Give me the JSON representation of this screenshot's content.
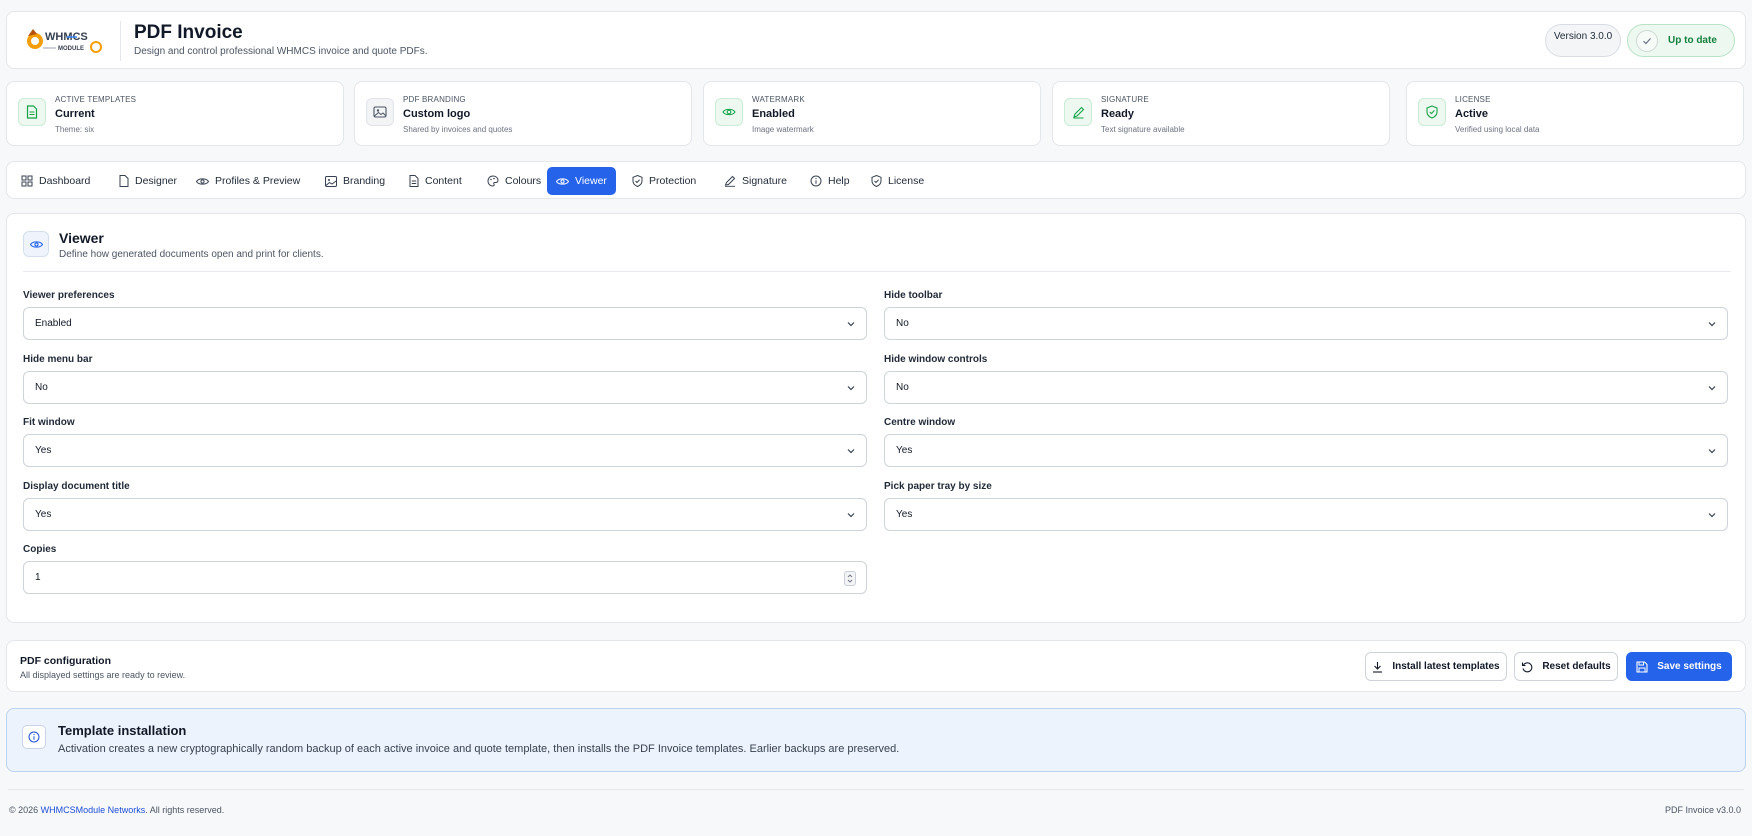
{
  "header": {
    "logo_text": "WHMCS MODULE",
    "title": "PDF Invoice",
    "subtitle": "Design and control professional WHMCS invoice and quote PDFs.",
    "version": "Version 3.0.0",
    "status": "Up to date"
  },
  "stats": [
    {
      "label": "Active templates",
      "value": "Current",
      "sub": "Theme: six",
      "icon": "file-icon"
    },
    {
      "label": "PDF branding",
      "value": "Custom logo",
      "sub": "Shared by invoices and quotes",
      "icon": "image-icon"
    },
    {
      "label": "Watermark",
      "value": "Enabled",
      "sub": "Image watermark",
      "icon": "eye-icon"
    },
    {
      "label": "Signature",
      "value": "Ready",
      "sub": "Text signature available",
      "icon": "pen-icon"
    },
    {
      "label": "License",
      "value": "Active",
      "sub": "Verified using local data",
      "icon": "shield-check-icon"
    }
  ],
  "tabs": [
    {
      "label": "Dashboard",
      "icon": "grid-icon"
    },
    {
      "label": "Designer",
      "icon": "file-icon"
    },
    {
      "label": "Profiles & Preview",
      "icon": "eye-icon"
    },
    {
      "label": "Branding",
      "icon": "image-icon"
    },
    {
      "label": "Content",
      "icon": "file-text-icon"
    },
    {
      "label": "Colours",
      "icon": "palette-icon"
    },
    {
      "label": "Viewer",
      "icon": "eye-icon",
      "active": true
    },
    {
      "label": "Protection",
      "icon": "shield-check-icon"
    },
    {
      "label": "Signature",
      "icon": "pen-icon"
    },
    {
      "label": "Help",
      "icon": "info-icon"
    },
    {
      "label": "License",
      "icon": "shield-check-icon"
    }
  ],
  "viewer": {
    "title": "Viewer",
    "subtitle": "Define how generated documents open and print for clients.",
    "fields": {
      "viewer_preferences": {
        "label": "Viewer preferences",
        "value": "Enabled"
      },
      "hide_toolbar": {
        "label": "Hide toolbar",
        "value": "No"
      },
      "hide_menu_bar": {
        "label": "Hide menu bar",
        "value": "No"
      },
      "hide_window_controls": {
        "label": "Hide window controls",
        "value": "No"
      },
      "fit_window": {
        "label": "Fit window",
        "value": "Yes"
      },
      "centre_window": {
        "label": "Centre window",
        "value": "Yes"
      },
      "display_document_title": {
        "label": "Display document title",
        "value": "Yes"
      },
      "pick_paper_tray": {
        "label": "Pick paper tray by size",
        "value": "Yes"
      },
      "copies": {
        "label": "Copies",
        "value": "1"
      }
    }
  },
  "config": {
    "title": "PDF configuration",
    "subtitle": "All displayed settings are ready to review.",
    "install_label": "Install latest templates",
    "reset_label": "Reset defaults",
    "save_label": "Save settings"
  },
  "info": {
    "title": "Template installation",
    "text": "Activation creates a new cryptographically random backup of each active invoice and quote template, then installs the PDF Invoice templates. Earlier backups are preserved."
  },
  "footer": {
    "copyright_prefix": "© 2026",
    "company": "WHMCSModule Networks",
    "rights": "All rights reserved.",
    "product": "PDF Invoice v3.0.0"
  },
  "colors": {
    "accent": "#2563eb",
    "success": "#15803d",
    "info_bg": "#edf3fc"
  }
}
